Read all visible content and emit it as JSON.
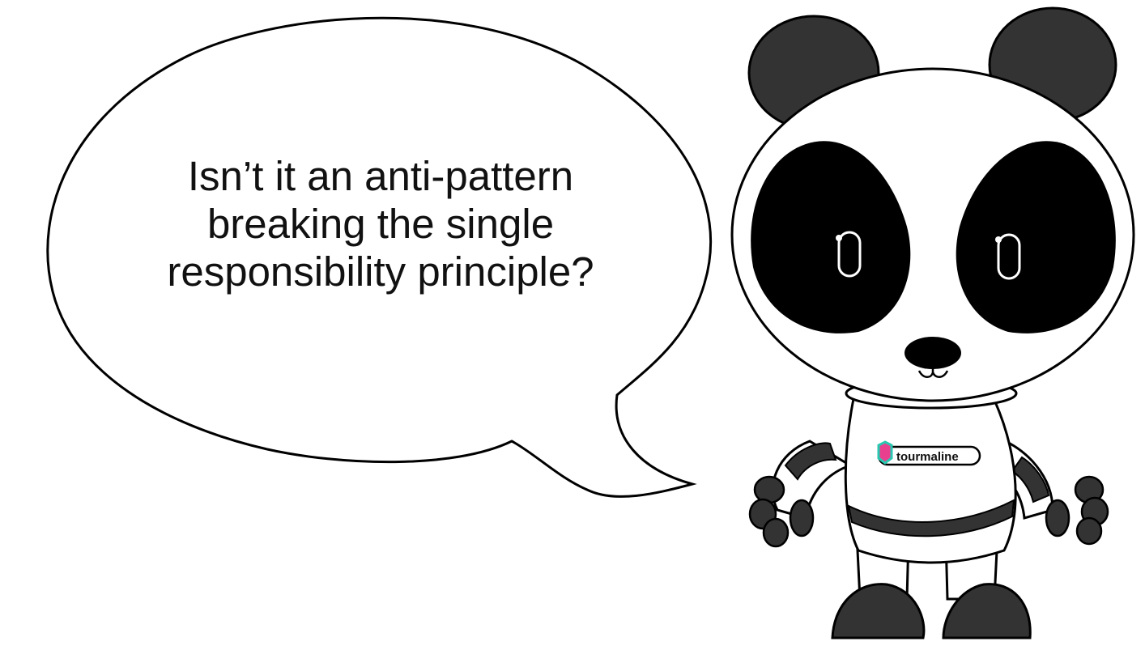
{
  "speech_bubble": {
    "lines": [
      "Isn’t it an anti-pattern",
      "breaking the single",
      "responsibility principle?"
    ]
  },
  "panda": {
    "shirt_logo_text": "tourmaline"
  },
  "colors": {
    "outline": "#000000",
    "fill_dark": "#333333",
    "fill_white": "#ffffff",
    "logo_pink": "#e8408f",
    "logo_teal": "#29c7b0"
  }
}
